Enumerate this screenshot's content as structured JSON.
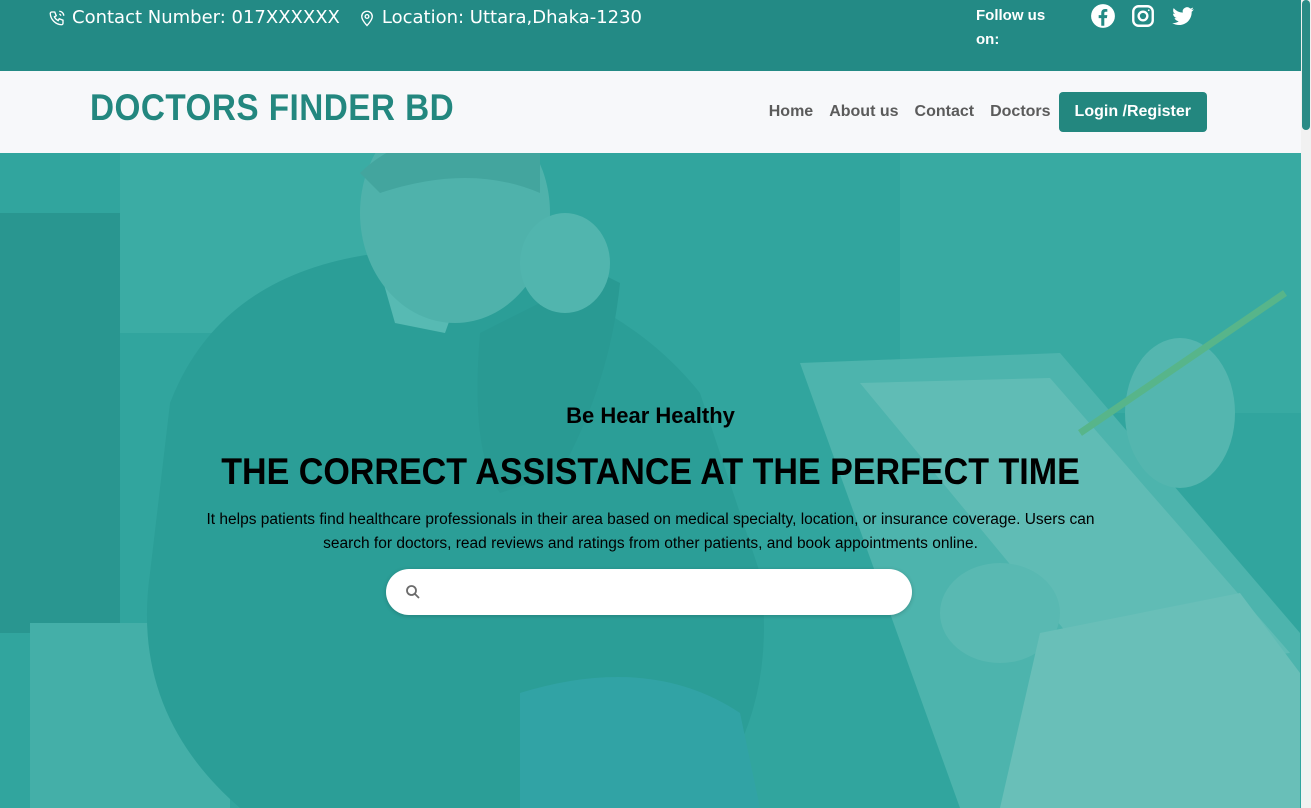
{
  "topbar": {
    "contact_label": "Contact Number: 017XXXXXX",
    "location_label": "Location: Uttara,Dhaka-1230",
    "follow_label": "Follow us on:",
    "social_icons": [
      "facebook-icon",
      "instagram-icon",
      "twitter-icon"
    ]
  },
  "navbar": {
    "brand": "DOCTORS FINDER BD",
    "links": [
      {
        "label": "Home"
      },
      {
        "label": "About us"
      },
      {
        "label": "Contact"
      },
      {
        "label": "Doctors"
      }
    ],
    "login_label": "Login /Register"
  },
  "hero": {
    "tagline": "Be Hear Healthy",
    "headline": "THE CORRECT ASSISTANCE AT THE PERFECT TIME",
    "description": "It helps patients find healthcare professionals in their area based on medical specialty, location, or insurance coverage. Users can search for doctors, read reviews and ratings from other patients, and book appointments online.",
    "search_placeholder": ""
  },
  "colors": {
    "brand": "#23877f",
    "topbar": "#238a85",
    "hero_tint": "#2ea39b",
    "nav_bg": "#f7f8fa",
    "nav_text": "#5b5b5b"
  }
}
